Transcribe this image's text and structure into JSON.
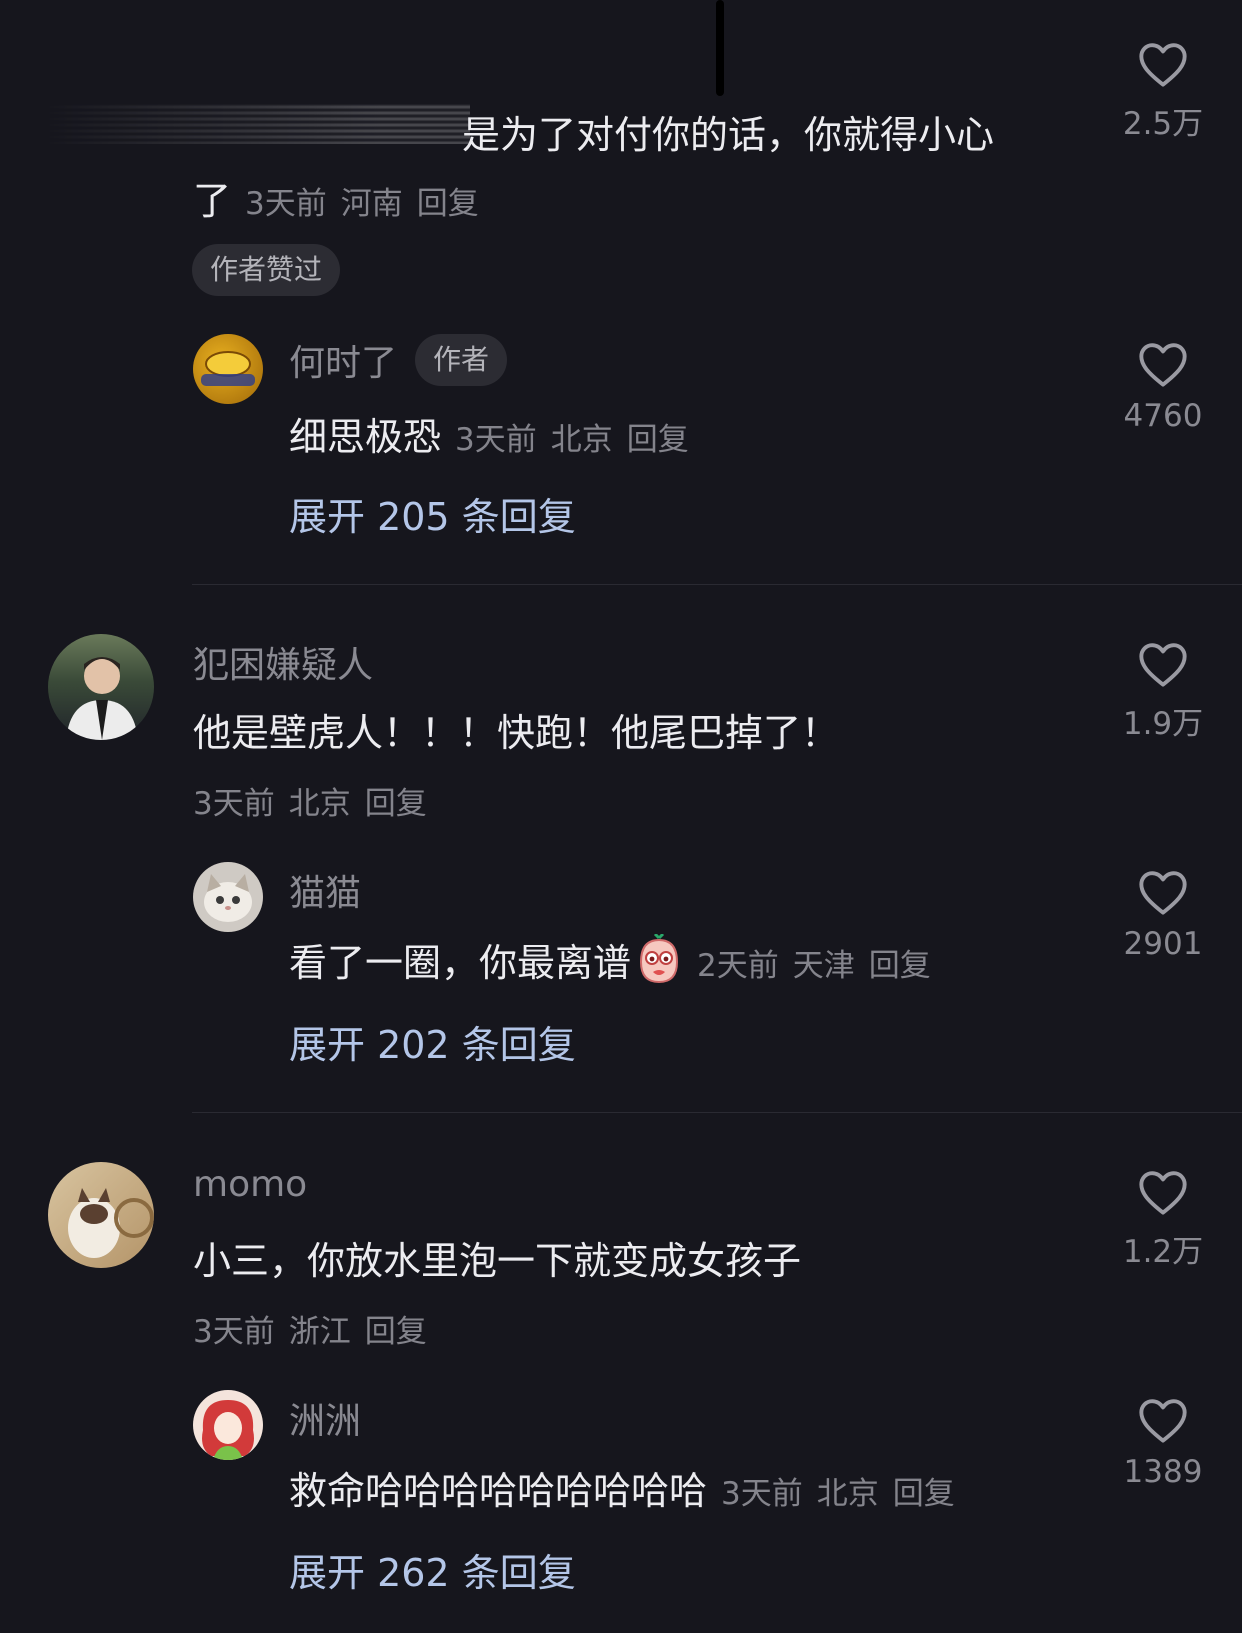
{
  "comments": [
    {
      "text_line1": "是为了对付你的话，你就得小心",
      "text_line2": "了",
      "time": "3天前",
      "location": "河南",
      "reply": "回复",
      "likes": "2.5万",
      "badge": "作者赞过",
      "sub": {
        "name": "何时了",
        "author_tag": "作者",
        "text": "细思极恐",
        "time": "3天前",
        "location": "北京",
        "reply": "回复",
        "likes": "4760",
        "expand": "展开 205 条回复"
      }
    },
    {
      "name": "犯困嫌疑人",
      "text": "他是壁虎人！！！快跑！他尾巴掉了！",
      "time": "3天前",
      "location": "北京",
      "reply": "回复",
      "likes": "1.9万",
      "sub": {
        "name": "猫猫",
        "text": "看了一圈，你最离谱",
        "time": "2天前",
        "location": "天津",
        "reply": "回复",
        "likes": "2901",
        "expand": "展开 202 条回复"
      }
    },
    {
      "name": "momo",
      "text": "小三，你放水里泡一下就变成女孩子",
      "time": "3天前",
      "location": "浙江",
      "reply": "回复",
      "likes": "1.2万",
      "sub": {
        "name": "洲洲",
        "text": "救命哈哈哈哈哈哈哈哈哈",
        "time": "3天前",
        "location": "北京",
        "reply": "回复",
        "likes": "1389",
        "expand": "展开 262 条回复"
      }
    }
  ],
  "icons": {
    "like": "heart-outline-icon",
    "emoji": "blushing-face-emoji-icon"
  },
  "colors": {
    "background": "#16161d",
    "expand_link": "#b4c6e8",
    "meta": "#84848c"
  }
}
